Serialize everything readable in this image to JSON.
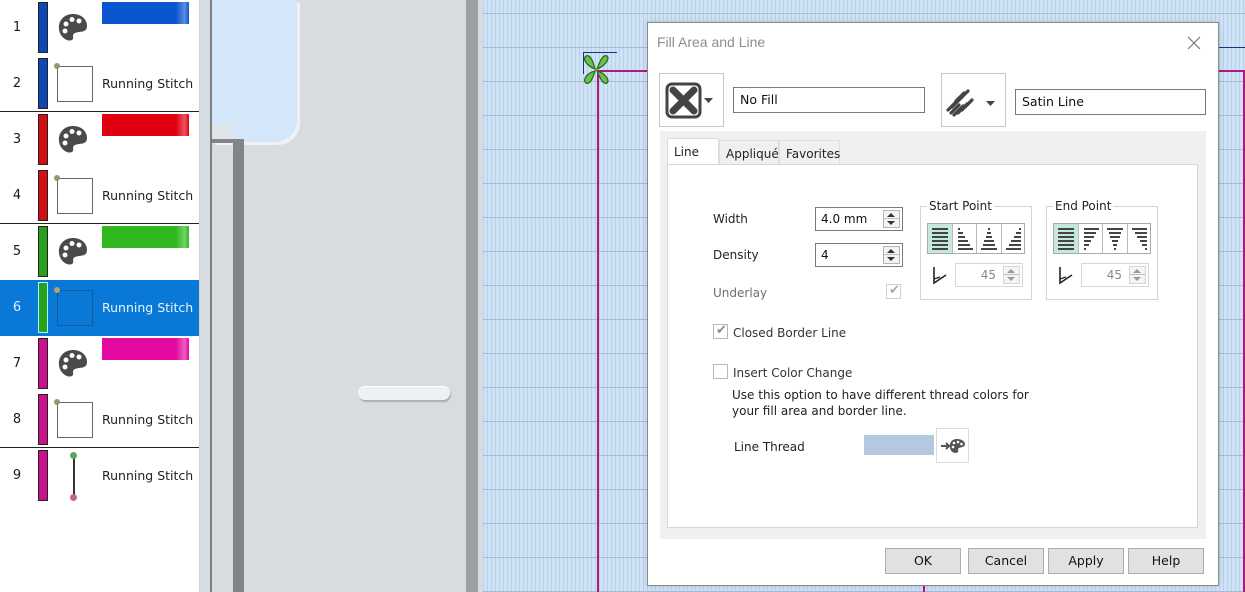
{
  "object_list": {
    "rows": [
      {
        "num": "1",
        "type": "color",
        "thread_color": "#0f48b4",
        "swatch_color": "#0a55d0"
      },
      {
        "num": "2",
        "type": "shape",
        "thread_color": "#0f48b4",
        "label": "Running Stitch"
      },
      {
        "num": "3",
        "type": "color",
        "thread_color": "#d40f14",
        "swatch_color": "#e00010"
      },
      {
        "num": "4",
        "type": "shape",
        "thread_color": "#d40f14",
        "label": "Running Stitch"
      },
      {
        "num": "5",
        "type": "color",
        "thread_color": "#2aa11e",
        "swatch_color": "#30b820"
      },
      {
        "num": "6",
        "type": "shape",
        "thread_color": "#2aa11e",
        "label": "Running Stitch",
        "selected": true
      },
      {
        "num": "7",
        "type": "color",
        "thread_color": "#c8118a",
        "swatch_color": "#e40aa0"
      },
      {
        "num": "8",
        "type": "shape",
        "thread_color": "#c8118a",
        "label": "Running Stitch"
      },
      {
        "num": "9",
        "type": "line",
        "thread_color": "#c8118a",
        "label": "Running Stitch"
      }
    ],
    "selection_color": "#0a78d7"
  },
  "dialog": {
    "title": "Fill Area and Line",
    "close_icon": "close-icon",
    "fill": {
      "icon": "no-fill-icon",
      "value": "No Fill"
    },
    "line": {
      "icon": "satin-line-icon",
      "value": "Satin Line"
    },
    "tabs": [
      {
        "label": "Line",
        "active": true
      },
      {
        "label": "Appliqué",
        "active": false
      },
      {
        "label": "Favorites",
        "active": false
      }
    ],
    "line_tab": {
      "width_label": "Width",
      "width_value": "4.0 mm",
      "density_label": "Density",
      "density_value": "4",
      "underlay_label": "Underlay",
      "underlay_checked": true,
      "underlay_disabled": true,
      "start_point": {
        "title": "Start Point",
        "angle": "45",
        "selected_index": 0
      },
      "end_point": {
        "title": "End Point",
        "angle": "45",
        "selected_index": 0
      },
      "closed_border_label": "Closed Border Line",
      "closed_border_checked": true,
      "insert_color_label": "Insert Color Change",
      "insert_color_checked": false,
      "insert_color_description": "Use this option to have different thread colors for your fill area and border line.",
      "line_thread_label": "Line Thread",
      "line_thread_color": "#b5c8e2",
      "line_thread_button_icon": "arrow-palette-icon"
    },
    "buttons": {
      "ok": "OK",
      "cancel": "Cancel",
      "apply": "Apply",
      "help": "Help"
    }
  },
  "canvas": {
    "hoop_color": "#b0187a",
    "grid_color": "#cfe3f6"
  }
}
